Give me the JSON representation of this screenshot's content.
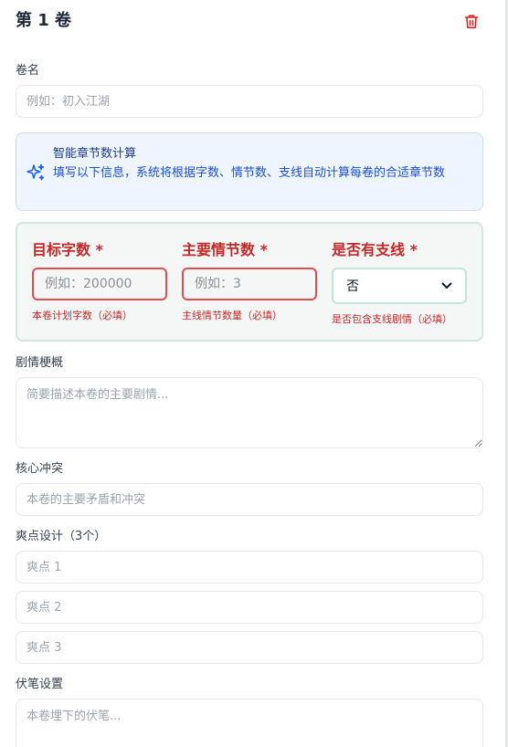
{
  "volume": {
    "title": "第 1 卷",
    "delete_icon": "trash-icon"
  },
  "name_field": {
    "label": "卷名",
    "placeholder": "例如：初入江湖"
  },
  "info_box": {
    "icon": "sparkle-icon",
    "title": "智能章节数计算",
    "description": "填写以下信息，系统将根据字数、情节数、支线自动计算每卷的合适章节数"
  },
  "required": {
    "word_count": {
      "label": "目标字数 *",
      "placeholder": "例如：200000",
      "hint": "本卷计划字数（必填）"
    },
    "plot_count": {
      "label": "主要情节数 *",
      "placeholder": "例如：3",
      "hint": "主线情节数量（必填）"
    },
    "subplot": {
      "label": "是否有支线 *",
      "value": "否",
      "hint": "是否包含支线剧情（必填）"
    }
  },
  "synopsis": {
    "label": "剧情梗概",
    "placeholder": "简要描述本卷的主要剧情..."
  },
  "conflict": {
    "label": "核心冲突",
    "placeholder": "本卷的主要矛盾和冲突"
  },
  "highlights": {
    "label": "爽点设计（3个）",
    "items": [
      {
        "placeholder": "爽点 1"
      },
      {
        "placeholder": "爽点 2"
      },
      {
        "placeholder": "爽点 3"
      }
    ]
  },
  "foreshadow": {
    "label": "伏笔设置",
    "placeholder": "本卷埋下的伏笔..."
  },
  "colors": {
    "required_text": "#c62828",
    "info_background": "#eef5fe",
    "required_background": "#f5f7f6",
    "delete_icon": "#dc2626"
  }
}
